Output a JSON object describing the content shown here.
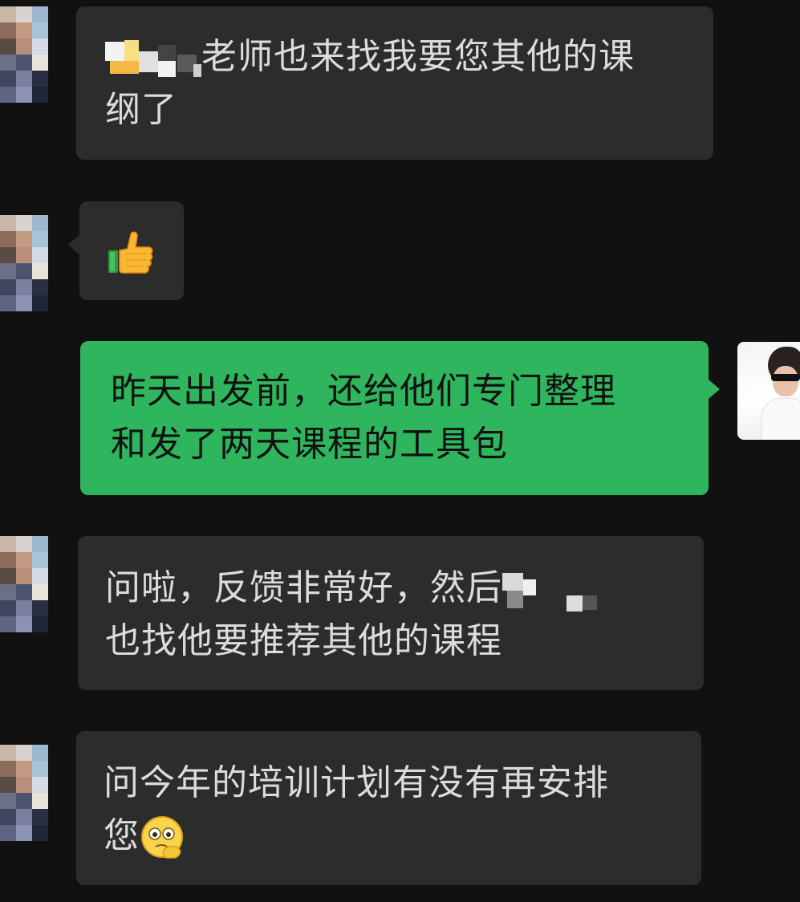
{
  "messages": [
    {
      "side": "incoming",
      "text_line1": "老师也来找我要您其他的课",
      "text_line2": "纲了"
    },
    {
      "side": "incoming",
      "emoji": "thumbs-up-icon"
    },
    {
      "side": "outgoing",
      "text_line1": "昨天出发前，还给他们专门整理",
      "text_line2": "和发了两天课程的工具包"
    },
    {
      "side": "incoming",
      "text_line1": "问啦，反馈非常好，然后",
      "text_line2": "也找他要推荐其他的课程"
    },
    {
      "side": "incoming",
      "text_line1": "问今年的培训计划有没有再安排",
      "text_line2": "您",
      "trailing_emoji": "thinking-face-icon"
    }
  ],
  "colors": {
    "background": "#111111",
    "incoming_bubble": "#2c2c2c",
    "outgoing_bubble": "#2fb55e",
    "incoming_text": "#dcdcdc",
    "outgoing_text": "#111111"
  }
}
